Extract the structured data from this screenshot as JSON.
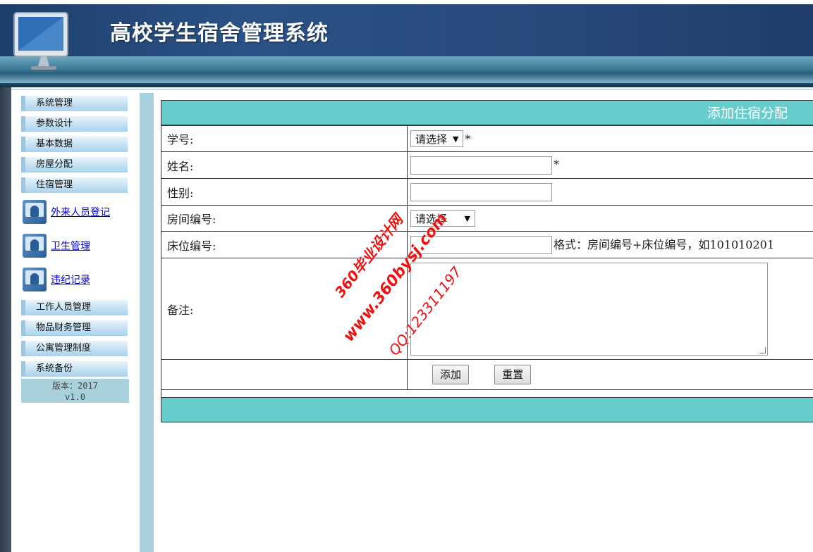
{
  "header": {
    "title": "高校学生宿舍管理系统"
  },
  "sidebar": {
    "menu_top": [
      {
        "label": "系统管理"
      },
      {
        "label": "参数设计"
      },
      {
        "label": "基本数据"
      },
      {
        "label": "房屋分配"
      },
      {
        "label": "住宿管理"
      }
    ],
    "links": [
      {
        "label": "外来人员登记",
        "icon": "user-window-icon"
      },
      {
        "label": "卫生管理",
        "icon": "user-window-icon"
      },
      {
        "label": "违纪记录",
        "icon": "user-window-icon"
      }
    ],
    "menu_bottom": [
      {
        "label": "工作人员管理"
      },
      {
        "label": "物品财务管理"
      },
      {
        "label": "公寓管理制度"
      },
      {
        "label": "系统备份"
      }
    ],
    "version_line1": "版本：2017",
    "version_line2": "v1.0"
  },
  "form": {
    "heading": "添加住宿分配",
    "fields": {
      "student_id": {
        "label": "学号:",
        "select_value": "请选择",
        "required_mark": "*"
      },
      "name": {
        "label": "姓名:",
        "value": "",
        "required_mark": "*"
      },
      "gender": {
        "label": "性别:",
        "value": ""
      },
      "room_no": {
        "label": "房间编号:",
        "select_value": "请选择"
      },
      "bed_no": {
        "label": "床位编号:",
        "value": "",
        "hint": "格式：房间编号+床位编号，如101010201"
      },
      "remark": {
        "label": "备注:",
        "value": ""
      }
    },
    "buttons": {
      "submit": "添加",
      "reset": "重置"
    }
  },
  "watermark": {
    "line1": "360毕业设计网",
    "line2": "www.360bysj.com",
    "line3": "QQ:123311197"
  },
  "colors": {
    "header_dark": "#27497a",
    "table_header": "#66cccc",
    "sidebar_divider": "#a9d1dc",
    "link": "#0000cc",
    "watermark": "#ee1111"
  }
}
